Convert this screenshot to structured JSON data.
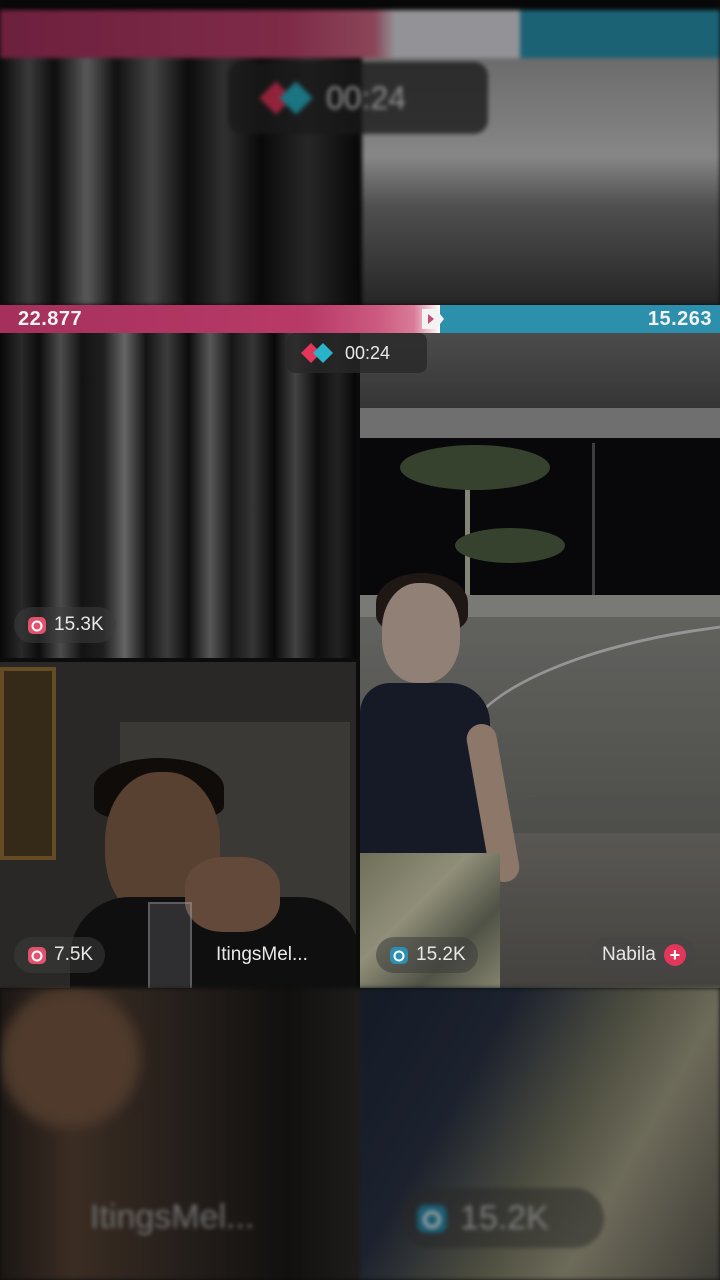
{
  "battle": {
    "left_score": "22.877",
    "right_score": "15.263",
    "timer": "00:24",
    "left_color": "#b83a67",
    "right_color": "#2c90ad"
  },
  "tiles": [
    {
      "viewer_count": "15.3K",
      "icon": "gift-box-icon",
      "name": ""
    },
    {
      "viewer_count": "15.2K",
      "icon": "shield-icon",
      "name": "Nabila"
    },
    {
      "viewer_count": "7.5K",
      "icon": "gift-box-icon",
      "name": "ItingsMel..."
    }
  ],
  "ghost_top": {
    "timer": "00:24"
  },
  "ghost_bottom": {
    "name": "ItingsMel...",
    "viewer_count": "15.2K"
  }
}
